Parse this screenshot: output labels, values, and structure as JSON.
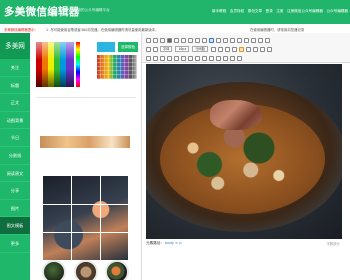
{
  "header": {
    "title": "多美微信编辑器",
    "subtitle": "国内最好用的公众号编辑平台",
    "nav": [
      "新手教程",
      "会员特权",
      "原创文章",
      "登录",
      "注册",
      "注册微信公众号编辑器",
      "公众号编辑器"
    ]
  },
  "notice": {
    "prefix": "多美微信编辑器提示：",
    "text": "1. 尽可能使用谷歌或者360浏览器，在使用编辑器时请尽量使用最新版本，",
    "extra": "在使用编辑器时，请常用浏览器记录"
  },
  "leftnav": {
    "brand": "多美网",
    "items": [
      "关注",
      "标题",
      "正文",
      "动图背景",
      "节日",
      "分割线",
      "阅读原文",
      "分享",
      "图片",
      "图文模板",
      "更多"
    ],
    "active_index": 9
  },
  "colorpicker": {
    "selected": "#2bb5e0",
    "button": "选择颜色"
  },
  "toolbar": {
    "font_size": "16px",
    "font_family": "字体",
    "line_height": "行间距"
  },
  "editor": {
    "status_prefix": "元素路径：",
    "status_path": "body > p",
    "count": "字数统计"
  }
}
